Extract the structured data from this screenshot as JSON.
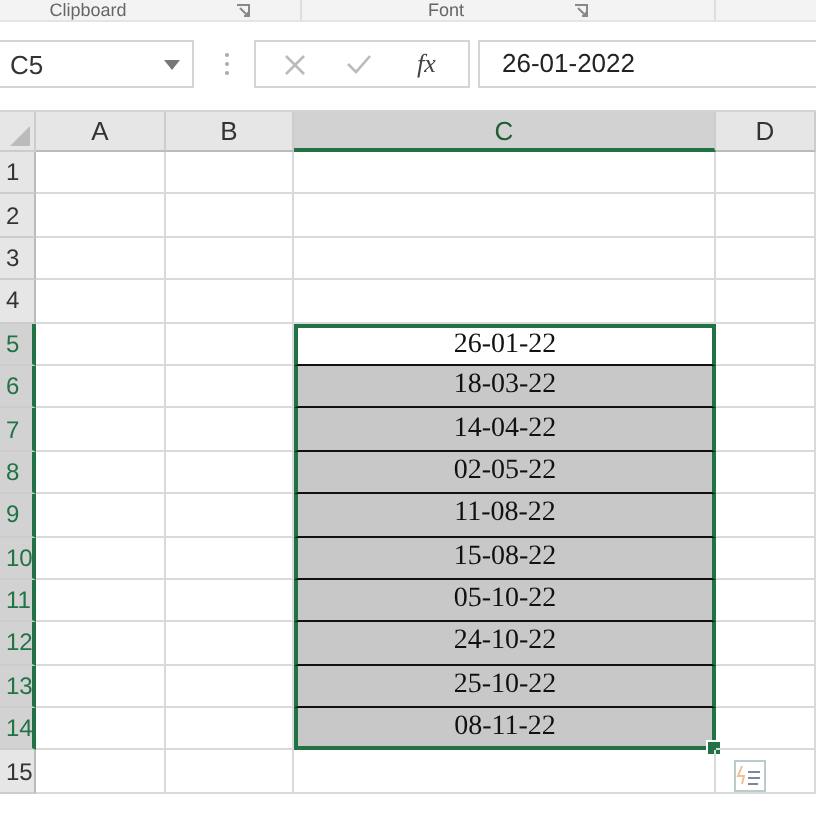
{
  "ribbon_groups": [
    {
      "label": "Clipboard"
    },
    {
      "label": "Font"
    }
  ],
  "name_box": {
    "value": "C5"
  },
  "formula_bar": {
    "function_label": "fx",
    "value": "26-01-2022"
  },
  "columns": [
    {
      "label": "A",
      "selected": false
    },
    {
      "label": "B",
      "selected": false
    },
    {
      "label": "C",
      "selected": true
    },
    {
      "label": "D",
      "selected": false
    }
  ],
  "rows": [
    {
      "header": "1",
      "selected": false,
      "active": false
    },
    {
      "header": "2",
      "selected": false,
      "active": false
    },
    {
      "header": "3",
      "selected": false,
      "active": false
    },
    {
      "header": "4",
      "selected": false,
      "active": false
    },
    {
      "header": "5",
      "selected": true,
      "active": true,
      "value": "26-01-22"
    },
    {
      "header": "6",
      "selected": true,
      "active": false,
      "value": "18-03-22"
    },
    {
      "header": "7",
      "selected": true,
      "active": false,
      "value": "14-04-22"
    },
    {
      "header": "8",
      "selected": true,
      "active": false,
      "value": "02-05-22"
    },
    {
      "header": "9",
      "selected": true,
      "active": false,
      "value": "11-08-22"
    },
    {
      "header": "10",
      "selected": true,
      "active": false,
      "value": "15-08-22"
    },
    {
      "header": "11",
      "selected": true,
      "active": false,
      "value": "05-10-22"
    },
    {
      "header": "12",
      "selected": true,
      "active": false,
      "value": "24-10-22"
    },
    {
      "header": "13",
      "selected": true,
      "active": false,
      "value": "25-10-22"
    },
    {
      "header": "14",
      "selected": true,
      "active": false,
      "value": "08-11-22"
    },
    {
      "header": "15",
      "selected": false,
      "active": false
    }
  ]
}
